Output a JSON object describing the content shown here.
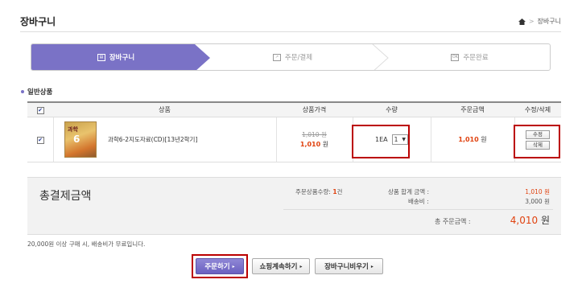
{
  "page": {
    "title": "장바구니"
  },
  "breadcrumb": {
    "home_icon": "home-icon",
    "separator": ">",
    "current": "장바구니"
  },
  "steps": [
    {
      "label": "장바구니",
      "icon": "cart-icon",
      "active": true
    },
    {
      "label": "주문/결제",
      "icon": "edit-icon",
      "active": false
    },
    {
      "label": "주문완료",
      "icon": "ok-icon",
      "active": false
    }
  ],
  "section": {
    "label": "일반상품"
  },
  "table": {
    "headers": [
      "상품",
      "상품가격",
      "수량",
      "주문금액",
      "수정/삭제"
    ],
    "rows": [
      {
        "checked": true,
        "thumb_title": "과학",
        "thumb_grade": "6",
        "name": "과학6-2지도자료(CD)[13년2학기]",
        "original_price": "1,010 원",
        "price": "1,010",
        "price_unit": "원",
        "qty_label": "1EA",
        "qty_value": "1",
        "order_amount": "1,010",
        "order_unit": "원",
        "edit_label": "수정",
        "delete_label": "삭제"
      }
    ]
  },
  "summary": {
    "title": "총결제금액",
    "count_label": "주문상품수량:",
    "count_value": "1",
    "count_unit": "건",
    "subtotal_label": "상품 합계 금액 :",
    "subtotal_value": "1,010 원",
    "shipping_label": "배송비 :",
    "shipping_value": "3,000 원",
    "total_label": "총 주문금액 :",
    "total_value": "4,010",
    "total_unit": "원"
  },
  "note": "20,000원 이상 구매 시, 배송비가 무료입니다.",
  "buttons": {
    "order": "주문하기",
    "continue": "쇼핑계속하기",
    "clear": "장바구니비우기"
  },
  "colors": {
    "accent": "#7a72c6",
    "price_red": "#e0420f",
    "highlight_box": "#b00000"
  }
}
